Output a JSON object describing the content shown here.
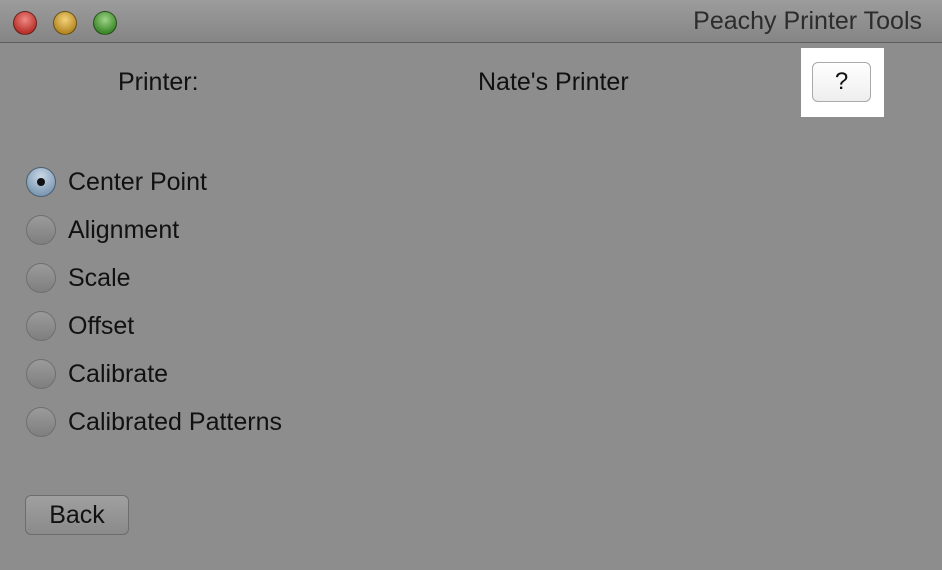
{
  "window": {
    "title": "Peachy Printer Tools"
  },
  "header": {
    "printer_label": "Printer:",
    "printer_name": "Nate's Printer",
    "help_label": "?"
  },
  "options": [
    {
      "label": "Center Point",
      "selected": true
    },
    {
      "label": "Alignment",
      "selected": false
    },
    {
      "label": "Scale",
      "selected": false
    },
    {
      "label": "Offset",
      "selected": false
    },
    {
      "label": "Calibrate",
      "selected": false
    },
    {
      "label": "Calibrated Patterns",
      "selected": false
    }
  ],
  "footer": {
    "back_label": "Back"
  }
}
